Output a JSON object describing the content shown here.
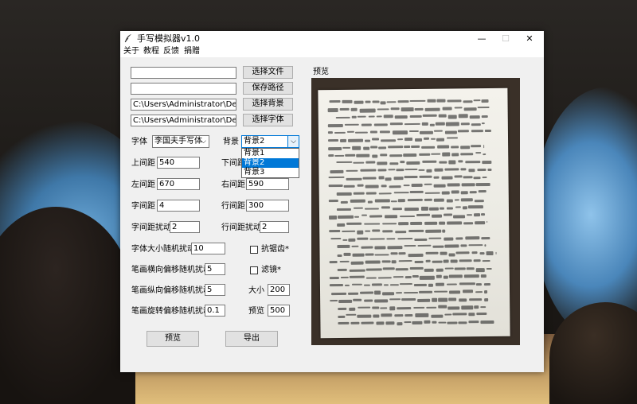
{
  "window": {
    "title": "手写模拟器v1.0",
    "controls": {
      "minimize": "—",
      "maximize": "☐",
      "close": "✕"
    }
  },
  "menu": [
    "关于",
    "教程",
    "反馈",
    "捐赠"
  ],
  "file_rows": [
    {
      "value": "",
      "button": "选择文件"
    },
    {
      "value": "",
      "button": "保存路径"
    },
    {
      "value": "C:\\Users\\Administrator\\Desktop\\手",
      "button": "选择背景"
    },
    {
      "value": "C:\\Users\\Administrator\\Desktop\\手",
      "button": "选择字体"
    }
  ],
  "font": {
    "label": "字体",
    "value": "李国夫手写体"
  },
  "background": {
    "label": "背景",
    "value": "背景2",
    "options": [
      "背景1",
      "背景2",
      "背景3"
    ],
    "selected_index": 1
  },
  "params": {
    "top_margin": {
      "label": "上间距",
      "value": "540"
    },
    "bottom_margin": {
      "label": "下间距",
      "value": ""
    },
    "left_margin": {
      "label": "左间距",
      "value": "670"
    },
    "right_margin": {
      "label": "右间距",
      "value": "590"
    },
    "char_spacing": {
      "label": "字间距",
      "value": "4"
    },
    "line_spacing": {
      "label": "行间距",
      "value": "300"
    },
    "char_jitter": {
      "label": "字间距扰动",
      "value": "2"
    },
    "line_jitter": {
      "label": "行间距扰动",
      "value": "2"
    },
    "size_jitter": {
      "label": "字体大小随机扰动",
      "value": "10"
    },
    "h_offset": {
      "label": "笔画横向偏移随机扰动",
      "value": "5"
    },
    "v_offset": {
      "label": "笔画纵向偏移随机扰动",
      "value": "5"
    },
    "rotation": {
      "label": "笔画旋转偏移随机扰动",
      "value": "0.1"
    }
  },
  "options": {
    "antialias": {
      "label": "抗锯齿*",
      "checked": false
    },
    "filter": {
      "label": "滤镜*",
      "checked": false
    },
    "size": {
      "label": "大小",
      "value": "200"
    },
    "preview": {
      "label": "预览",
      "value": "500"
    }
  },
  "actions": {
    "preview": "预览",
    "export": "导出"
  },
  "preview_panel": {
    "label": "预览"
  }
}
